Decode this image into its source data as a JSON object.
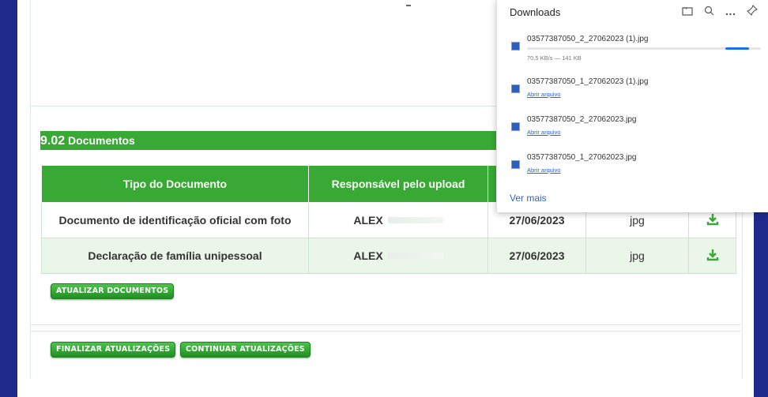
{
  "section": {
    "number": "9.02",
    "title": "Documentos"
  },
  "table": {
    "headers": [
      "Tipo do Documento",
      "Responsável pelo upload",
      "",
      "",
      ""
    ],
    "rows": [
      {
        "tipo": "Documento de identificação oficial com foto",
        "responsavel": "ALEX",
        "data": "27/06/2023",
        "ext": "jpg"
      },
      {
        "tipo": "Declaração de família unipessoal",
        "responsavel": "ALEX",
        "data": "27/06/2023",
        "ext": "jpg"
      }
    ]
  },
  "buttons": {
    "atualizar": "ATUALIZAR DOCUMENTOS",
    "finalizar": "FINALIZAR ATUALIZAÇÕES",
    "continuar": "CONTINUAR ATUALIZAÇÕES"
  },
  "downloads": {
    "title": "Downloads",
    "items": [
      {
        "name": "03577387050_2_27062023 (1).jpg",
        "status": "70,5 KB/s — 141 KB",
        "progress": 0.9
      },
      {
        "name": "03577387050_1_27062023 (1).jpg",
        "status": "Abrir arquivo"
      },
      {
        "name": "03577387050_2_27062023.jpg",
        "status": "Abrir arquivo"
      },
      {
        "name": "03577387050_1_27062023.jpg",
        "status": "Abrir arquivo"
      }
    ],
    "more": "Ver mais"
  },
  "colors": {
    "accent": "#39a935",
    "sidebar": "#1d2a8c",
    "link": "#2f63c7",
    "progress": "#1a73e8"
  },
  "icons": [
    "folder-icon",
    "search-icon",
    "more-icon",
    "pin-icon",
    "file-icon",
    "download-icon"
  ]
}
